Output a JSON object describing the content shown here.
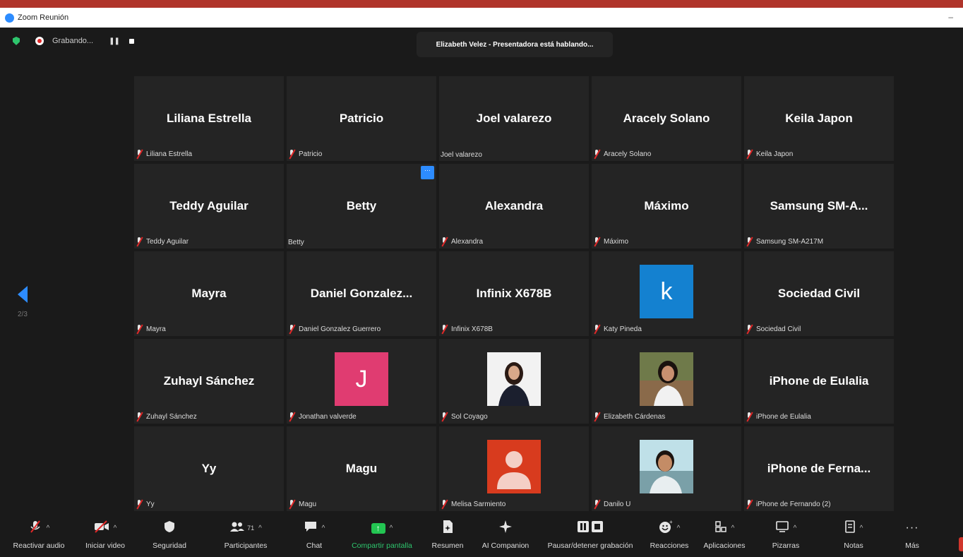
{
  "window": {
    "title": "Zoom Reunión",
    "minimize": "–"
  },
  "topbar": {
    "recording_label": "Grabando...",
    "pause_glyph": "❚❚"
  },
  "speaker_banner": "Elizabeth Velez - Presentadora está hablando...",
  "pager": {
    "current": "2/3"
  },
  "tiles": [
    {
      "name": "Liliana Estrella",
      "label": "Liliana Estrella",
      "muted": true
    },
    {
      "name": "Patricio",
      "label": "Patricio",
      "muted": true
    },
    {
      "name": "Joel valarezo",
      "label": "Joel valarezo",
      "muted": false
    },
    {
      "name": "Aracely Solano",
      "label": "Aracely Solano",
      "muted": true
    },
    {
      "name": "Keila Japon",
      "label": "Keila Japon",
      "muted": true
    },
    {
      "name": "Teddy Aguilar",
      "label": "Teddy Aguilar",
      "muted": true
    },
    {
      "name": "Betty",
      "label": "Betty",
      "muted": false,
      "more": "···"
    },
    {
      "name": "Alexandra",
      "label": "Alexandra",
      "muted": true
    },
    {
      "name": "Máximo",
      "label": "Máximo",
      "muted": true
    },
    {
      "name": "Samsung SM-A...",
      "label": "Samsung SM-A217M",
      "muted": true
    },
    {
      "name": "Mayra",
      "label": "Mayra",
      "muted": true
    },
    {
      "name": "Daniel Gonzalez...",
      "label": "Daniel Gonzalez Guerrero",
      "muted": true
    },
    {
      "name": "Infinix X678B",
      "label": "Infinix X678B",
      "muted": true
    },
    {
      "avatar_letter": "k",
      "avatar_color": "#1481d0",
      "label": "Katy Pineda",
      "muted": true
    },
    {
      "name": "Sociedad Civil",
      "label": "Sociedad Civil",
      "muted": true
    },
    {
      "name": "Zuhayl Sánchez",
      "label": "Zuhayl Sánchez",
      "muted": true
    },
    {
      "avatar_letter": "J",
      "avatar_color": "#e03c71",
      "label": "Jonathan valverde",
      "muted": true
    },
    {
      "photo": "woman-white-bg",
      "label": "Sol Coyago",
      "muted": true
    },
    {
      "photo": "woman-outdoor",
      "label": "Elizabeth Cárdenas",
      "muted": true
    },
    {
      "name": "iPhone de Eulalia",
      "label": "iPhone de Eulalia",
      "muted": true
    },
    {
      "name": "Yy",
      "label": "Yy",
      "muted": true
    },
    {
      "name": "Magu",
      "label": "Magu",
      "muted": true
    },
    {
      "photo": "default-avatar",
      "label": "Melisa Sarmiento",
      "muted": true
    },
    {
      "photo": "man-selfie",
      "label": "Danilo U",
      "muted": true
    },
    {
      "name": "iPhone de Ferna...",
      "label": "iPhone de Fernando (2)",
      "muted": true
    }
  ],
  "toolbar": {
    "audio": "Reactivar audio",
    "video": "Iniciar video",
    "security": "Seguridad",
    "participants": "Participantes",
    "participants_count": "71",
    "chat": "Chat",
    "share": "Compartir pantalla",
    "summary": "Resumen",
    "companion": "AI Companion",
    "record": "Pausar/detener grabación",
    "reactions": "Reacciones",
    "apps": "Aplicaciones",
    "whiteboards": "Pizarras",
    "notes": "Notas",
    "more": "Más"
  },
  "colors": {
    "accent": "#2d8cff",
    "share_green": "#23c552",
    "muted_red": "#e02828"
  }
}
